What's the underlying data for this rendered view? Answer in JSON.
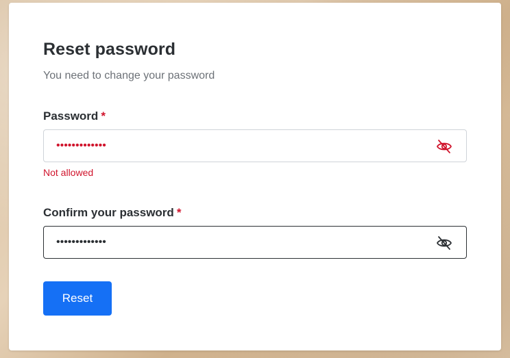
{
  "form": {
    "title": "Reset password",
    "subtitle": "You need to change your password",
    "password": {
      "label": "Password",
      "required_mark": "*",
      "value": "•••••••••••••",
      "error": "Not allowed",
      "icon": "eye-slash-icon"
    },
    "confirm": {
      "label": "Confirm your password",
      "required_mark": "*",
      "value": "•••••••••••••",
      "icon": "eye-slash-icon"
    },
    "submit_label": "Reset"
  },
  "colors": {
    "accent": "#1570f5",
    "error": "#d0142c",
    "text": "#2b2f33",
    "muted": "#6c7177"
  }
}
